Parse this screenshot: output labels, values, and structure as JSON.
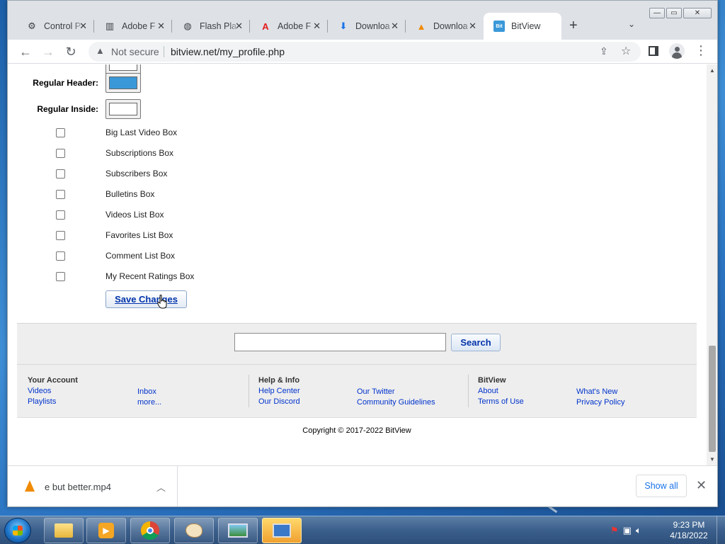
{
  "browser": {
    "tabs": [
      {
        "label": "Control P",
        "icon": "control-panel-icon"
      },
      {
        "label": "Adobe F",
        "icon": "adobe-archive-icon"
      },
      {
        "label": "Flash Pla",
        "icon": "globe-icon"
      },
      {
        "label": "Adobe F",
        "icon": "adobe-icon"
      },
      {
        "label": "Downloa",
        "icon": "download-icon"
      },
      {
        "label": "Downloa",
        "icon": "vlc-icon"
      },
      {
        "label": "BitView",
        "icon": "bitview-icon",
        "active": true
      }
    ],
    "security_label": "Not secure",
    "url": "bitview.net/my_profile.php"
  },
  "page": {
    "fields": [
      {
        "label": "Regular Header:",
        "color": "#3a98d8"
      },
      {
        "label": "Regular Inside:",
        "color": "#ffffff"
      }
    ],
    "checkboxes": [
      "Big Last Video Box",
      "Subscriptions Box",
      "Subscribers Box",
      "Bulletins Box",
      "Videos List Box",
      "Favorites List Box",
      "Comment List Box",
      "My Recent Ratings Box"
    ],
    "save_label": "Save Changes",
    "search": {
      "value": "",
      "button": "Search"
    },
    "footer": {
      "your_account": {
        "heading": "Your Account",
        "links": [
          "Videos",
          "Playlists",
          "Inbox",
          "more..."
        ]
      },
      "help": {
        "heading": "Help & Info",
        "links": [
          "Help Center",
          "Our Discord",
          "Our Twitter",
          "Community Guidelines"
        ]
      },
      "bitview": {
        "heading": "BitView",
        "links": [
          "About",
          "Terms of Use",
          "What's New",
          "Privacy Policy"
        ]
      }
    },
    "copyright": "Copyright © 2017-2022 BitView"
  },
  "downloads": {
    "file": "e but better.mp4",
    "show_all": "Show all"
  },
  "taskbar": {
    "time": "9:23 PM",
    "date": "4/18/2022"
  },
  "colors": {
    "link": "#0033cc",
    "accent": "#1a73e8"
  }
}
